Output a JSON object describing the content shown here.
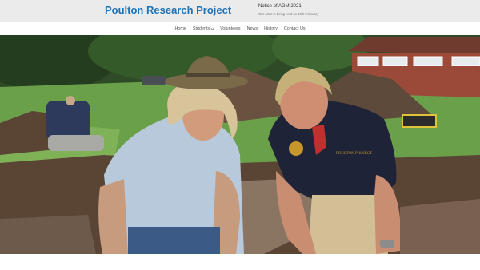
{
  "header": {
    "site_title": "Poulton Research Project",
    "notice_title": "Notice of AGM 2021",
    "notice_text": "Our AGM is being held on 18th February"
  },
  "nav": {
    "items": [
      {
        "label": "Home"
      },
      {
        "label": "Students"
      },
      {
        "label": "Volunteers"
      },
      {
        "label": "News"
      },
      {
        "label": "History"
      },
      {
        "label": "Contact Us"
      }
    ]
  },
  "hero": {
    "shirt_text": "POULTON PROJECT",
    "colors": {
      "title_blue": "#1f73b7",
      "grass": "#6ba04a",
      "soil": "#5a4535",
      "brick": "#9b4a3a"
    }
  }
}
